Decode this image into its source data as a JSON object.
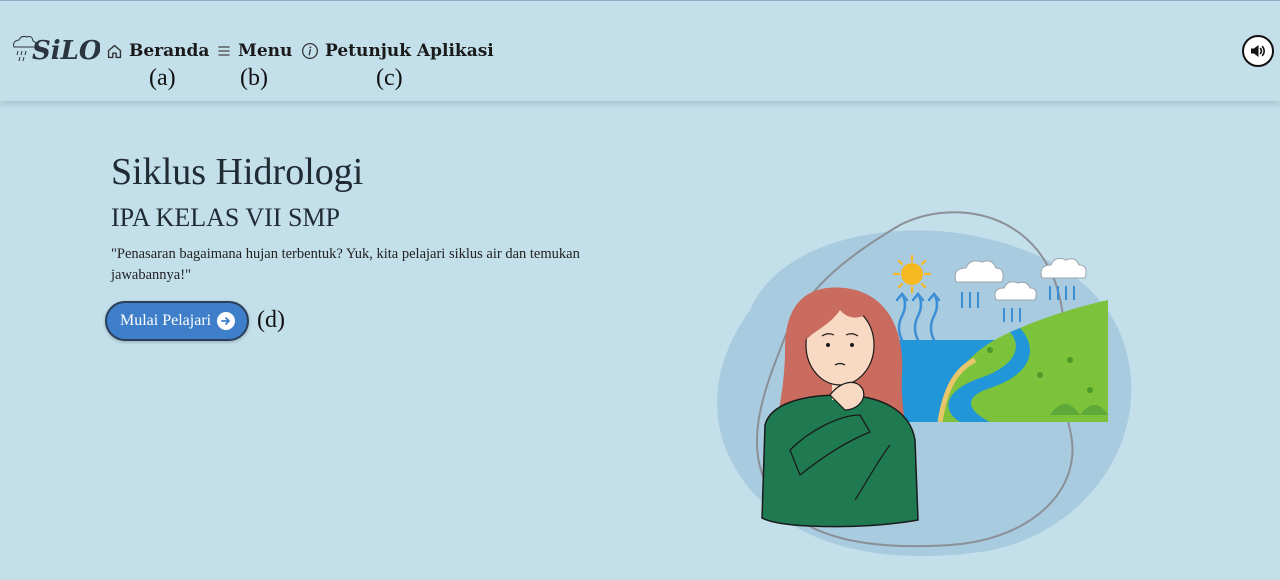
{
  "nav": {
    "items": [
      {
        "label": "Beranda",
        "icon": "home-icon",
        "annotation": "(a)"
      },
      {
        "label": "Menu",
        "icon": "menu-icon",
        "annotation": "(b)"
      },
      {
        "label": "Petunjuk Aplikasi",
        "icon": "info-icon",
        "annotation": "(c)"
      }
    ],
    "sound_icon": "speaker-icon",
    "logo_icon": "silo-logo"
  },
  "hero": {
    "title": "Siklus Hidrologi",
    "subtitle": "IPA KELAS VII SMP",
    "quote": "\"Penasaran bagaimana hujan terbentuk? Yuk, kita pelajari siklus air dan temukan jawabannya!\"",
    "button_label": "Mulai Pelajari",
    "button_annotation": "(d)",
    "button_icon": "arrow-right-circle-icon"
  },
  "colors": {
    "background": "#c3dfea",
    "button": "#3f7fc9",
    "blob": "#a9cbe0"
  }
}
